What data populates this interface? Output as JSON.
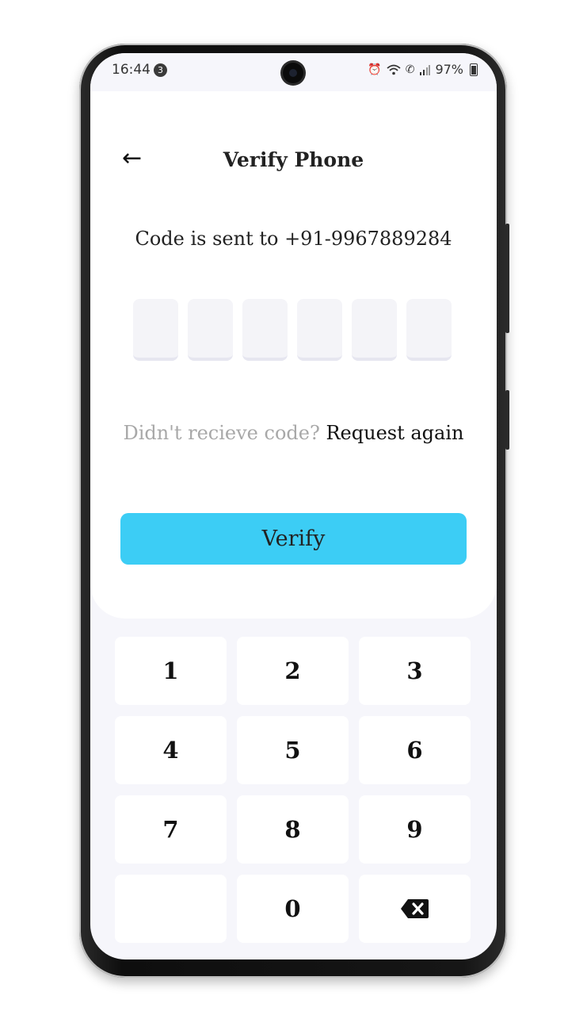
{
  "status_bar": {
    "time": "16:44",
    "notification_count": "3",
    "battery": "97%"
  },
  "header": {
    "back_icon": "arrow-left-icon",
    "title": "Verify Phone"
  },
  "verification": {
    "code_sent_text": "Code is sent to +91-9967889284",
    "otp_length": 6,
    "otp_values": [
      "",
      "",
      "",
      "",
      "",
      ""
    ]
  },
  "resend": {
    "prompt": "Didn't recieve code?",
    "link": "Request again"
  },
  "verify_button": {
    "label": "Verify",
    "color": "#3ccdf5"
  },
  "keypad": {
    "keys": [
      "1",
      "2",
      "3",
      "4",
      "5",
      "6",
      "7",
      "8",
      "9",
      "",
      "0",
      "backspace-icon"
    ]
  }
}
